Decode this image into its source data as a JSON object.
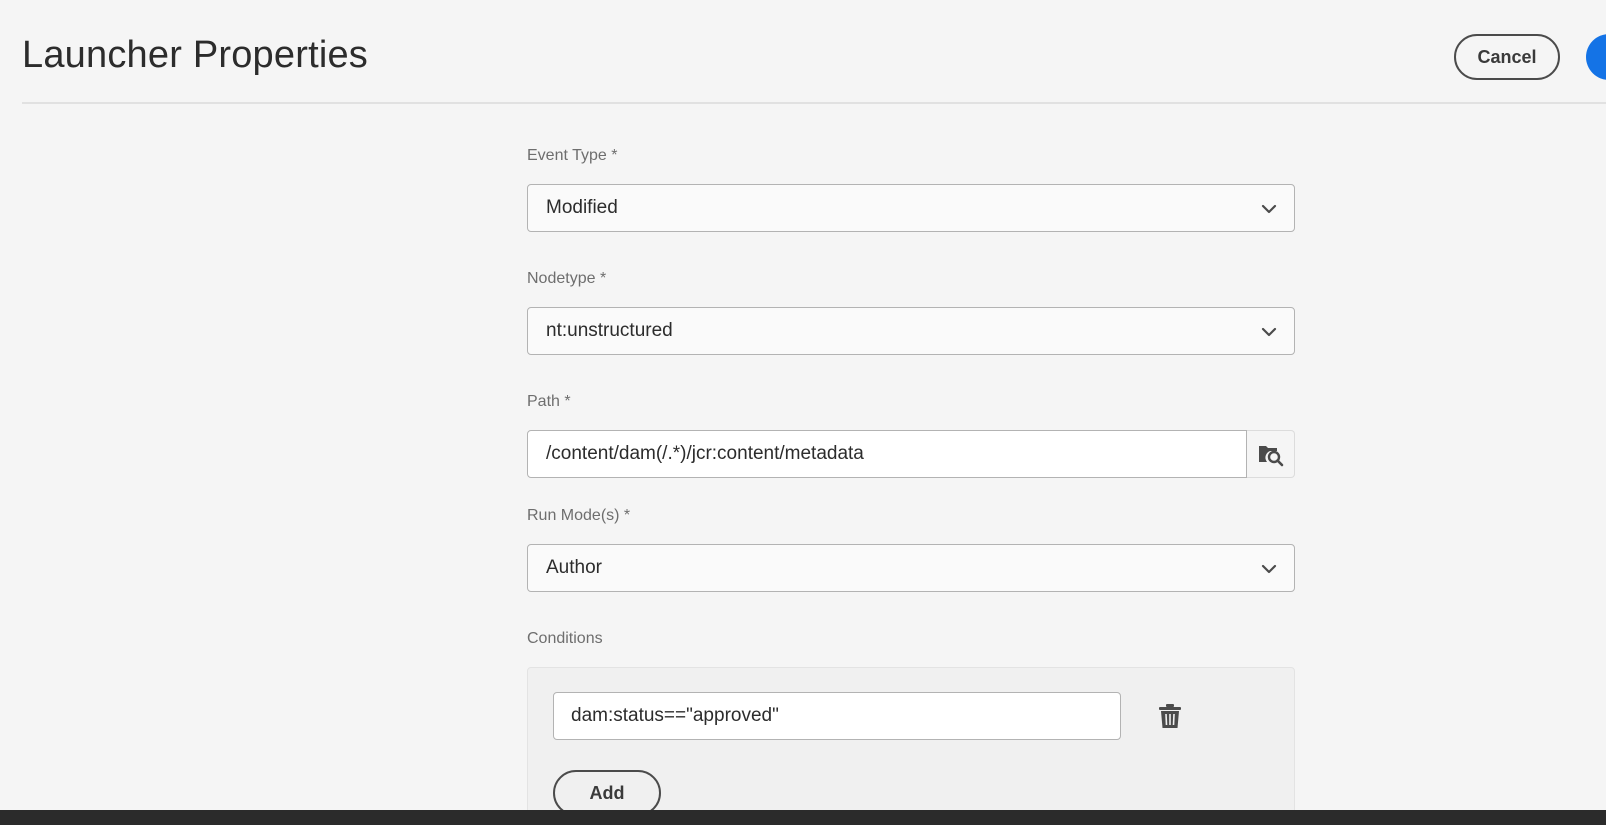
{
  "header": {
    "title": "Launcher Properties",
    "cancel_label": "Cancel"
  },
  "form": {
    "event_type": {
      "label": "Event Type *",
      "value": "Modified"
    },
    "nodetype": {
      "label": "Nodetype *",
      "value": "nt:unstructured"
    },
    "path": {
      "label": "Path *",
      "value": "/content/dam(/.*)/jcr:content/metadata"
    },
    "run_modes": {
      "label": "Run Mode(s) *",
      "value": "Author"
    },
    "conditions": {
      "label": "Conditions",
      "items": [
        "dam:status==\"approved\""
      ],
      "add_label": "Add"
    }
  },
  "icons": {
    "dropdown": "chevron-down-icon",
    "browse": "folder-search-icon",
    "delete": "trash-icon"
  },
  "colors": {
    "accent": "#1473e6",
    "background": "#f5f5f5"
  }
}
